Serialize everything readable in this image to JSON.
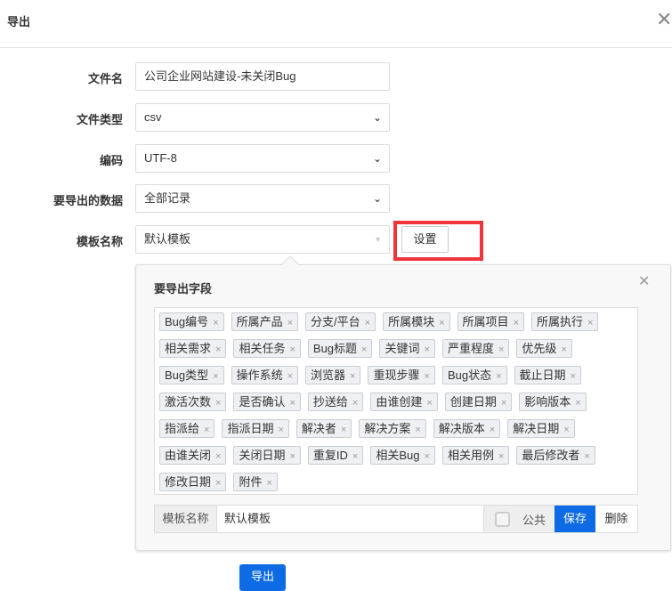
{
  "dialog": {
    "title": "导出"
  },
  "form": {
    "filename": {
      "label": "文件名",
      "value": "公司企业网站建设-未关闭Bug"
    },
    "filetype": {
      "label": "文件类型",
      "value": "csv"
    },
    "encoding": {
      "label": "编码",
      "value": "UTF-8"
    },
    "data": {
      "label": "要导出的数据",
      "value": "全部记录"
    },
    "template": {
      "label": "模板名称",
      "value": "默认模板",
      "settings_label": "设置"
    }
  },
  "popover": {
    "title": "要导出字段",
    "fields": [
      "Bug编号",
      "所属产品",
      "分支/平台",
      "所属模块",
      "所属项目",
      "所属执行",
      "相关需求",
      "相关任务",
      "Bug标题",
      "关键词",
      "严重程度",
      "优先级",
      "Bug类型",
      "操作系统",
      "浏览器",
      "重现步骤",
      "Bug状态",
      "截止日期",
      "激活次数",
      "是否确认",
      "抄送给",
      "由谁创建",
      "创建日期",
      "影响版本",
      "指派给",
      "指派日期",
      "解决者",
      "解决方案",
      "解决版本",
      "解决日期",
      "由谁关闭",
      "关闭日期",
      "重复ID",
      "相关Bug",
      "相关用例",
      "最后修改者",
      "修改日期",
      "附件"
    ],
    "template_name_label": "模板名称",
    "template_name_value": "默认模板",
    "public_label": "公共",
    "save_label": "保存",
    "delete_label": "删除"
  },
  "export_label": "导出"
}
